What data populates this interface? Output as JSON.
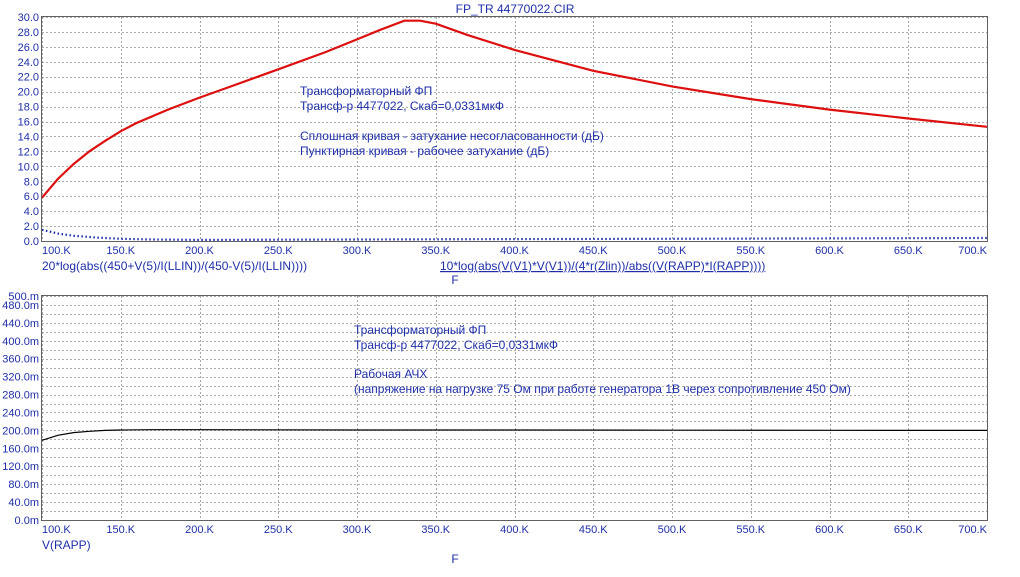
{
  "window": {
    "title": "FP_TR 44770022.CIR"
  },
  "colors": {
    "text_blue": "#1f2fa8",
    "red_curve": "#dd1010",
    "blue_curve": "#1a2aa8",
    "black_curve": "#000000",
    "grid": "#909090",
    "frame": "#606060"
  },
  "chart_data": [
    {
      "type": "line",
      "title": "FP_TR 44770022.CIR",
      "x_axis": {
        "label": "F",
        "range": [
          100000,
          700000
        ],
        "ticks": [
          100000,
          150000,
          200000,
          250000,
          300000,
          350000,
          400000,
          450000,
          500000,
          550000,
          600000,
          650000,
          700000
        ],
        "tick_labels": [
          "100.K",
          "150.K",
          "200.K",
          "250.K",
          "300.K",
          "350.K",
          "400.K",
          "450.K",
          "500.K",
          "550.K",
          "600.K",
          "650.K",
          "700.K"
        ]
      },
      "y_axis": {
        "range": [
          0,
          30
        ],
        "ticks": [
          0,
          2,
          4,
          6,
          8,
          10,
          12,
          14,
          16,
          18,
          20,
          22,
          24,
          26,
          28,
          30
        ],
        "tick_labels": [
          "0.0",
          "2.0",
          "4.0",
          "6.0",
          "8.0",
          "10.0",
          "12.0",
          "14.0",
          "16.0",
          "18.0",
          "20.0",
          "22.0",
          "24.0",
          "26.0",
          "28.0",
          "30.0"
        ]
      },
      "grid": true,
      "series_expressions": [
        "20*log(abs((450+V(5)/I(LLIN))/(450-V(5)/I(LLIN))))",
        "10*log(abs(V(V1)*V(V1))/(4*r(Zlin))/abs((V(RAPP)*I(RAPP))))"
      ],
      "annotations": [
        "Трансформаторный ФП",
        "Трансф-р 4477022, Скаб=0,0331мкФ",
        "Сплошная кривая - затухание несогласованности (дБ)",
        "Пунктирная кривая - рабочее затухание (дБ)"
      ],
      "series": [
        {
          "style": "solid",
          "color": "#dd1010",
          "x": [
            100000,
            110000,
            120000,
            130000,
            140000,
            150000,
            160000,
            180000,
            200000,
            220000,
            250000,
            280000,
            300000,
            315000,
            330000,
            340000,
            350000,
            370000,
            400000,
            450000,
            500000,
            550000,
            600000,
            650000,
            700000
          ],
          "y": [
            5.8,
            8.3,
            10.3,
            12.0,
            13.4,
            14.7,
            15.8,
            17.6,
            19.2,
            20.7,
            23.0,
            25.3,
            27.0,
            28.3,
            29.5,
            29.5,
            29.1,
            27.6,
            25.6,
            22.8,
            20.7,
            19.0,
            17.6,
            16.4,
            15.3
          ]
        },
        {
          "style": "dotted",
          "color": "#1a2aa8",
          "x": [
            100000,
            110000,
            120000,
            135000,
            150000,
            170000,
            200000,
            300000,
            400000,
            500000,
            600000,
            700000
          ],
          "y": [
            1.5,
            1.0,
            0.7,
            0.45,
            0.3,
            0.2,
            0.15,
            0.2,
            0.25,
            0.3,
            0.35,
            0.4
          ]
        }
      ]
    },
    {
      "type": "line",
      "x_axis": {
        "label": "F",
        "range": [
          100000,
          700000
        ],
        "ticks": [
          100000,
          150000,
          200000,
          250000,
          300000,
          350000,
          400000,
          450000,
          500000,
          550000,
          600000,
          650000,
          700000
        ],
        "tick_labels": [
          "100.K",
          "150.K",
          "200.K",
          "250.K",
          "300.K",
          "350.K",
          "400.K",
          "450.K",
          "500.K",
          "550.K",
          "600.K",
          "650.K",
          "700.K"
        ]
      },
      "y_axis": {
        "range": [
          0,
          0.5
        ],
        "ticks": [
          0,
          0.02,
          0.04,
          0.06,
          0.08,
          0.1,
          0.12,
          0.14,
          0.16,
          0.18,
          0.2,
          0.22,
          0.24,
          0.26,
          0.28,
          0.3,
          0.32,
          0.34,
          0.36,
          0.38,
          0.4,
          0.42,
          0.44,
          0.46,
          0.48,
          0.5
        ],
        "tick_labels": [
          "0.0m",
          "40.0m",
          "80.0m",
          "120.0m",
          "160.0m",
          "200.0m",
          "240.0m",
          "280.0m",
          "320.0m",
          "360.0m",
          "400.0m",
          "440.0m",
          "480.0m",
          "500.m"
        ],
        "tick_label_values": [
          0,
          0.04,
          0.08,
          0.12,
          0.16,
          0.2,
          0.24,
          0.28,
          0.32,
          0.36,
          0.4,
          0.44,
          0.48,
          0.5
        ]
      },
      "grid": true,
      "series_expressions": [
        "V(RAPP)"
      ],
      "annotations": [
        "Трансформаторный ФП",
        "Трансф-р 4477022, Скаб=0,0331мкФ",
        "Рабочая АЧХ",
        "(напряжение на нагрузке 75 Ом при работе генератора 1В через сопротивление 450 Ом)"
      ],
      "series": [
        {
          "style": "solid",
          "color": "#000000",
          "x": [
            100000,
            110000,
            120000,
            130000,
            140000,
            150000,
            170000,
            200000,
            300000,
            400000,
            500000,
            600000,
            700000
          ],
          "y": [
            0.178,
            0.189,
            0.195,
            0.198,
            0.2,
            0.201,
            0.2015,
            0.2015,
            0.201,
            0.2008,
            0.2005,
            0.2003,
            0.2
          ]
        }
      ]
    }
  ]
}
